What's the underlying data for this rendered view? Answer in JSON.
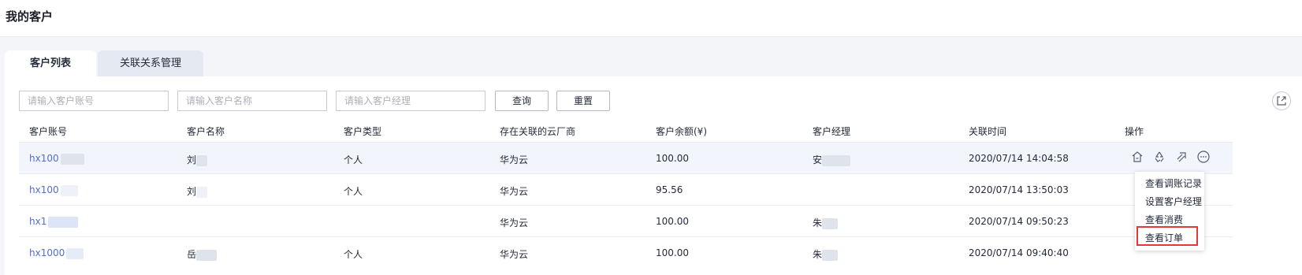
{
  "page": {
    "title": "我的客户"
  },
  "tabs": [
    {
      "label": "客户列表",
      "active": true
    },
    {
      "label": "关联关系管理",
      "active": false
    }
  ],
  "filters": {
    "account_placeholder": "请输入客户账号",
    "name_placeholder": "请输入客户名称",
    "manager_placeholder": "请输入客户经理",
    "query_label": "查询",
    "reset_label": "重置",
    "export_icon": "export-icon"
  },
  "table": {
    "columns": [
      "客户账号",
      "客户名称",
      "客户类型",
      "存在关联的云厂商",
      "客户余额(¥)",
      "客户经理",
      "关联时间",
      "操作"
    ],
    "rows": [
      {
        "account": "hx100",
        "name": "刘",
        "type": "个人",
        "cloud": "华为云",
        "balance": "100.00",
        "manager": "安",
        "time": "2020/07/14 14:04:58"
      },
      {
        "account": "hx100",
        "name": "刘",
        "type": "个人",
        "cloud": "华为云",
        "balance": "95.56",
        "manager": "",
        "time": "2020/07/14 13:50:03"
      },
      {
        "account": "hx1",
        "name": "",
        "type": "",
        "cloud": "华为云",
        "balance": "100.00",
        "manager": "朱",
        "time": "2020/07/14 09:50:23"
      },
      {
        "account": "hx1000",
        "name": "岳",
        "type": "个人",
        "cloud": "华为云",
        "balance": "100.00",
        "manager": "朱",
        "time": "2020/07/14 09:40:40"
      }
    ]
  },
  "actions": {
    "icons": [
      "home-icon",
      "recycle-icon",
      "link-icon",
      "more-icon"
    ]
  },
  "menu": {
    "items": [
      "查看调账记录",
      "设置客户经理",
      "查看消费",
      "查看订单"
    ],
    "highlighted": "查看订单"
  },
  "colors": {
    "link": "#526ecc",
    "highlight": "#e53935",
    "accent": "#526ecc"
  }
}
